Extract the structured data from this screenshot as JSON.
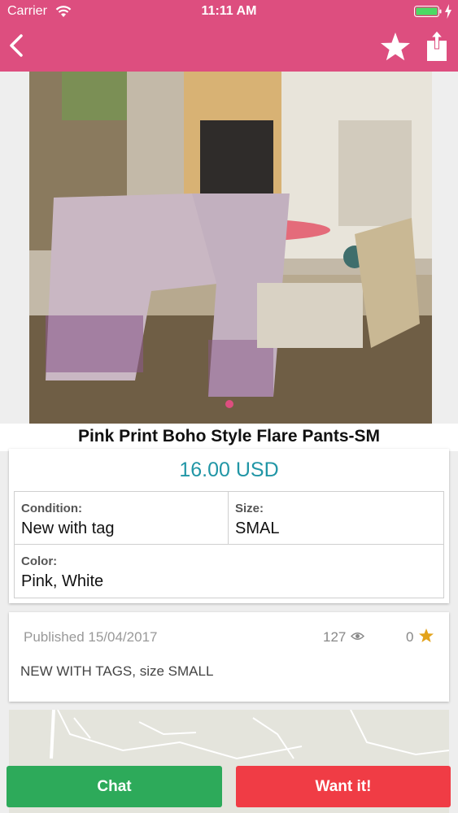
{
  "status_bar": {
    "carrier": "Carrier",
    "time": "11:11 AM"
  },
  "nav": {
    "back_icon": "chevron-left-icon",
    "favorite_icon": "star-icon",
    "share_icon": "share-icon"
  },
  "product": {
    "title": "Pink Print Boho Style Flare Pants-SM",
    "price": "16.00 USD",
    "condition_label": "Condition:",
    "condition_value": "New with tag",
    "size_label": "Size:",
    "size_value": "SMAL",
    "color_label": "Color:",
    "color_value": "Pink, White"
  },
  "details": {
    "published": "Published 15/04/2017",
    "views": "127",
    "favorites": "0",
    "description": "NEW WITH TAGS, size SMALL"
  },
  "actions": {
    "chat_label": "Chat",
    "want_label": "Want it!"
  },
  "colors": {
    "brand_pink": "#dd4e7f",
    "price_teal": "#2196a6",
    "chat_green": "#2daa5a",
    "want_red": "#f03c45",
    "star_gold": "#e3a31b"
  }
}
